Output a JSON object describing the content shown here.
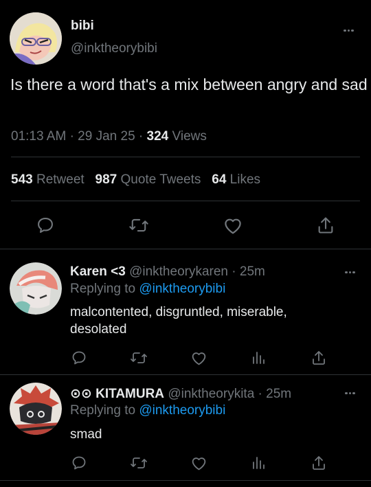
{
  "main_tweet": {
    "display_name": "bibi",
    "handle": "@inktheorybibi",
    "text": "Is there a word that's a mix between angry and sad",
    "time": "01:13 AM",
    "date": "29 Jan 25",
    "views_count": "324",
    "views_label": "Views",
    "retweets_count": "543",
    "retweets_label": "Retweet",
    "quotes_count": "987",
    "quotes_label": "Quote Tweets",
    "likes_count": "64",
    "likes_label": "Likes"
  },
  "replies": [
    {
      "display_name": "Karen <3",
      "handle": "@inktheorykaren",
      "time": "25m",
      "replying_prefix": "Replying to",
      "replying_to": "@inktheorybibi",
      "text": "malcontented, disgruntled, miserable, desolated"
    },
    {
      "display_name": "⊙⊙ KITAMURA",
      "handle": "@inktheorykita",
      "time": "25m",
      "replying_prefix": "Replying to",
      "replying_to": "@inktheorybibi",
      "text": "smad"
    }
  ],
  "separator": "·",
  "colors": {
    "background": "#000000",
    "text": "#e7e9ea",
    "muted": "#71767b",
    "link": "#1d9bf0",
    "divider": "#2f3336"
  },
  "icons": [
    "reply-icon",
    "retweet-icon",
    "like-icon",
    "views-icon",
    "share-icon",
    "more-icon"
  ]
}
